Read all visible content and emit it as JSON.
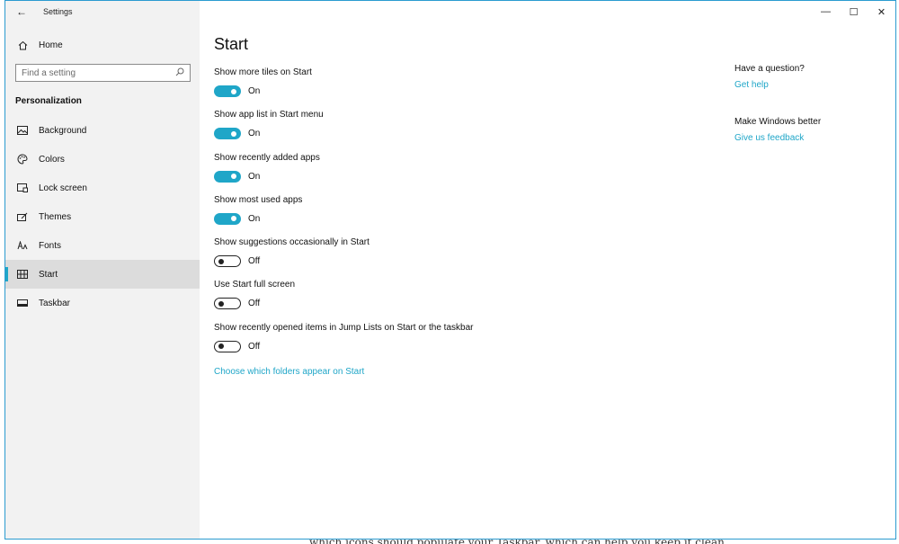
{
  "app": {
    "title": "Settings",
    "back_glyph": "←"
  },
  "window_controls": {
    "minimize": "—",
    "maximize": "☐",
    "close": "✕"
  },
  "sidebar": {
    "home_label": "Home",
    "search_placeholder": "Find a setting",
    "section_heading": "Personalization",
    "items": [
      {
        "label": "Background",
        "icon": "image-icon",
        "selected": false
      },
      {
        "label": "Colors",
        "icon": "palette-icon",
        "selected": false
      },
      {
        "label": "Lock screen",
        "icon": "lock-screen-icon",
        "selected": false
      },
      {
        "label": "Themes",
        "icon": "themes-icon",
        "selected": false
      },
      {
        "label": "Fonts",
        "icon": "fonts-icon",
        "selected": false
      },
      {
        "label": "Start",
        "icon": "start-icon",
        "selected": true
      },
      {
        "label": "Taskbar",
        "icon": "taskbar-icon",
        "selected": false
      }
    ]
  },
  "main": {
    "title": "Start",
    "settings": [
      {
        "label": "Show more tiles on Start",
        "state": "On"
      },
      {
        "label": "Show app list in Start menu",
        "state": "On"
      },
      {
        "label": "Show recently added apps",
        "state": "On"
      },
      {
        "label": "Show most used apps",
        "state": "On"
      },
      {
        "label": "Show suggestions occasionally in Start",
        "state": "Off"
      },
      {
        "label": "Use Start full screen",
        "state": "Off"
      },
      {
        "label": "Show recently opened items in Jump Lists on Start or the taskbar",
        "state": "Off"
      }
    ],
    "folders_link": "Choose which folders appear on Start"
  },
  "aside": {
    "question_heading": "Have a question?",
    "help_link": "Get help",
    "feedback_heading": "Make Windows better",
    "feedback_link": "Give us feedback"
  },
  "backdrop_text": "which icons should populate your Taskbar, which can help you keep it clean",
  "colors": {
    "accent": "#1fa6c8",
    "sidebar_bg": "#f2f2f2",
    "selected_bg": "#dcdcdc"
  }
}
